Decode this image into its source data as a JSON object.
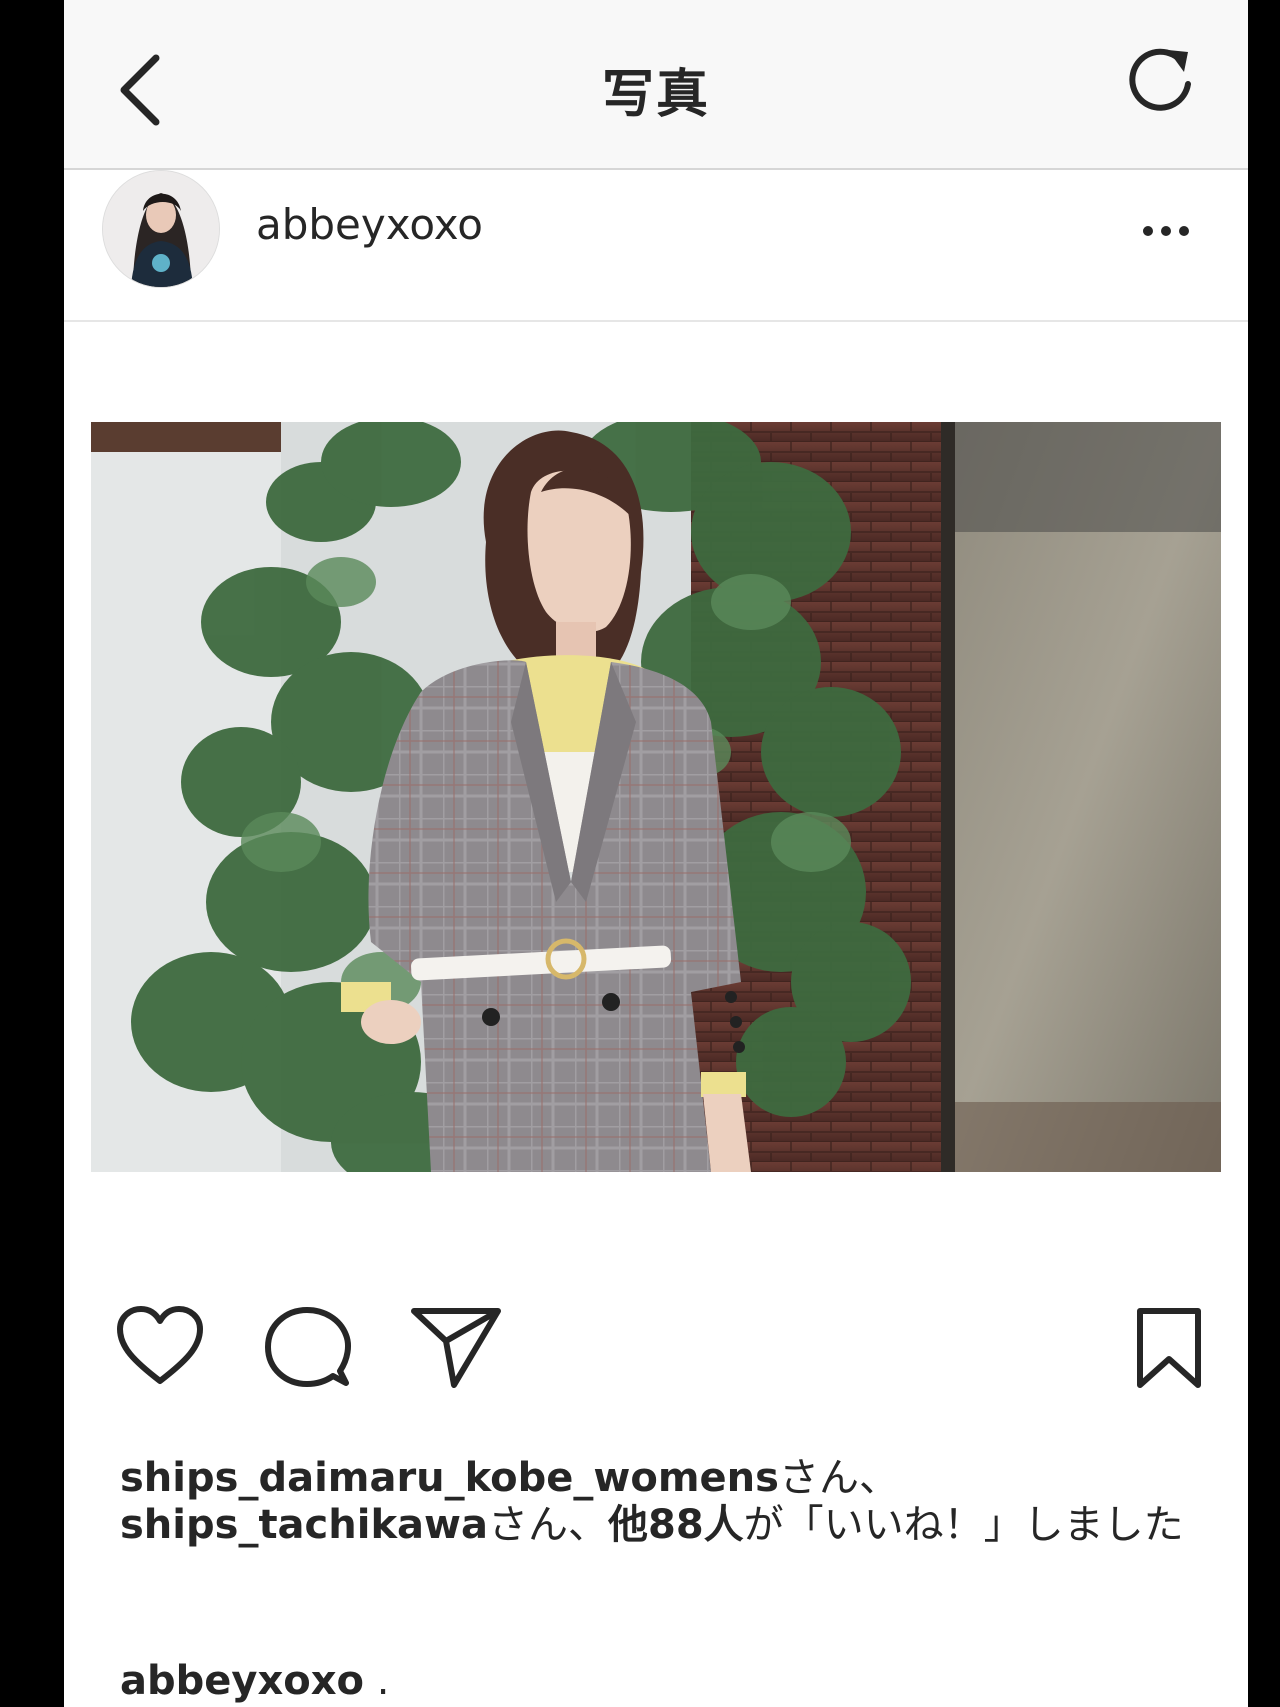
{
  "nav": {
    "title": "写真",
    "back_icon": "chevron-left-icon",
    "refresh_icon": "refresh-icon"
  },
  "post": {
    "username": "abbeyxoxo",
    "more_icon": "more-horizontal-icon",
    "photo_alt": "Woman in a grey check blazer with a white belt in front of ivy-covered brick wall"
  },
  "actions": {
    "like_icon": "heart-icon",
    "comment_icon": "comment-icon",
    "share_icon": "send-icon",
    "save_icon": "bookmark-icon"
  },
  "likes": {
    "user1": "ships_daimaru_kobe_womens",
    "sep1": "さん、",
    "user2": "ships_tachikawa",
    "sep2": "さん、",
    "others": "他88人",
    "suffix": "が「いいね！」しました"
  },
  "caption": {
    "username": "abbeyxoxo",
    "text": " ."
  },
  "colors": {
    "navbar_bg": "#f8f8f8",
    "text": "#262626",
    "screen_bg": "#ffffff",
    "frame": "#000000"
  }
}
